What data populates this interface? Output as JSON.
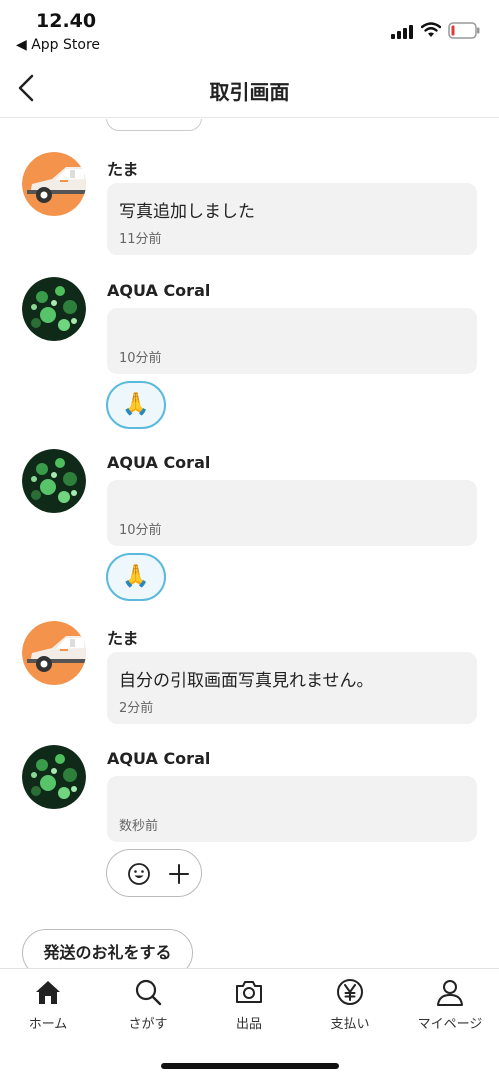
{
  "status_bar": {
    "time": "12.40",
    "back_app": "◀ App Store"
  },
  "header": {
    "title": "取引画面"
  },
  "messages": [
    {
      "author": "たま",
      "avatar": "car-avatar",
      "text": "写真追加しました",
      "time": "11分前"
    },
    {
      "author": "AQUA Coral",
      "avatar": "coral-avatar",
      "text": "",
      "time": "10分前",
      "reaction": "🙏"
    },
    {
      "author": "AQUA Coral",
      "avatar": "coral-avatar",
      "text": "",
      "time": "10分前",
      "reaction": "🙏"
    },
    {
      "author": "たま",
      "avatar": "car-avatar",
      "text": "自分の引取画面写真見れません。",
      "time": "2分前"
    },
    {
      "author": "AQUA Coral",
      "avatar": "coral-avatar",
      "text": "",
      "time": "数秒前"
    }
  ],
  "actions": {
    "thanks_button": "発送のお礼をする"
  },
  "tab_bar": {
    "items": [
      {
        "label": "ホーム",
        "icon": "home-icon"
      },
      {
        "label": "さがす",
        "icon": "search-icon"
      },
      {
        "label": "出品",
        "icon": "camera-icon"
      },
      {
        "label": "支払い",
        "icon": "yen-icon"
      },
      {
        "label": "マイページ",
        "icon": "person-icon"
      }
    ]
  },
  "colors": {
    "reaction_border": "#5bb9dc",
    "bubble_bg": "#f2f2f2",
    "car_avatar_bg": "#f4934c",
    "battery_low": "#e53935"
  }
}
